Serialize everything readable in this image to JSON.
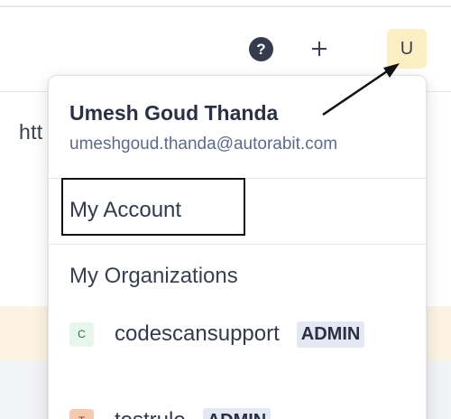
{
  "header": {
    "help_label": "?",
    "avatar_initial": "U",
    "add_icon": "plus-icon",
    "help_icon": "question-circle-icon"
  },
  "background": {
    "url_fragment": "htt"
  },
  "user_menu": {
    "name": "Umesh Goud Thanda",
    "email": "umeshgoud.thanda@autorabit.com",
    "my_account_label": "My Account",
    "organizations_heading": "My Organizations",
    "organizations": [
      {
        "initial": "C",
        "name": "codescansupport",
        "role": "ADMIN",
        "icon_color": "#e6f6ea"
      },
      {
        "initial": "T",
        "name": "testrule",
        "role": "ADMIN",
        "icon_color": "#f6c9b1"
      }
    ]
  },
  "colors": {
    "avatar_bg": "#fcefc4",
    "help_bg": "#363b4d",
    "email_text": "#5c6b8a",
    "badge_bg": "#e4e8f3"
  }
}
